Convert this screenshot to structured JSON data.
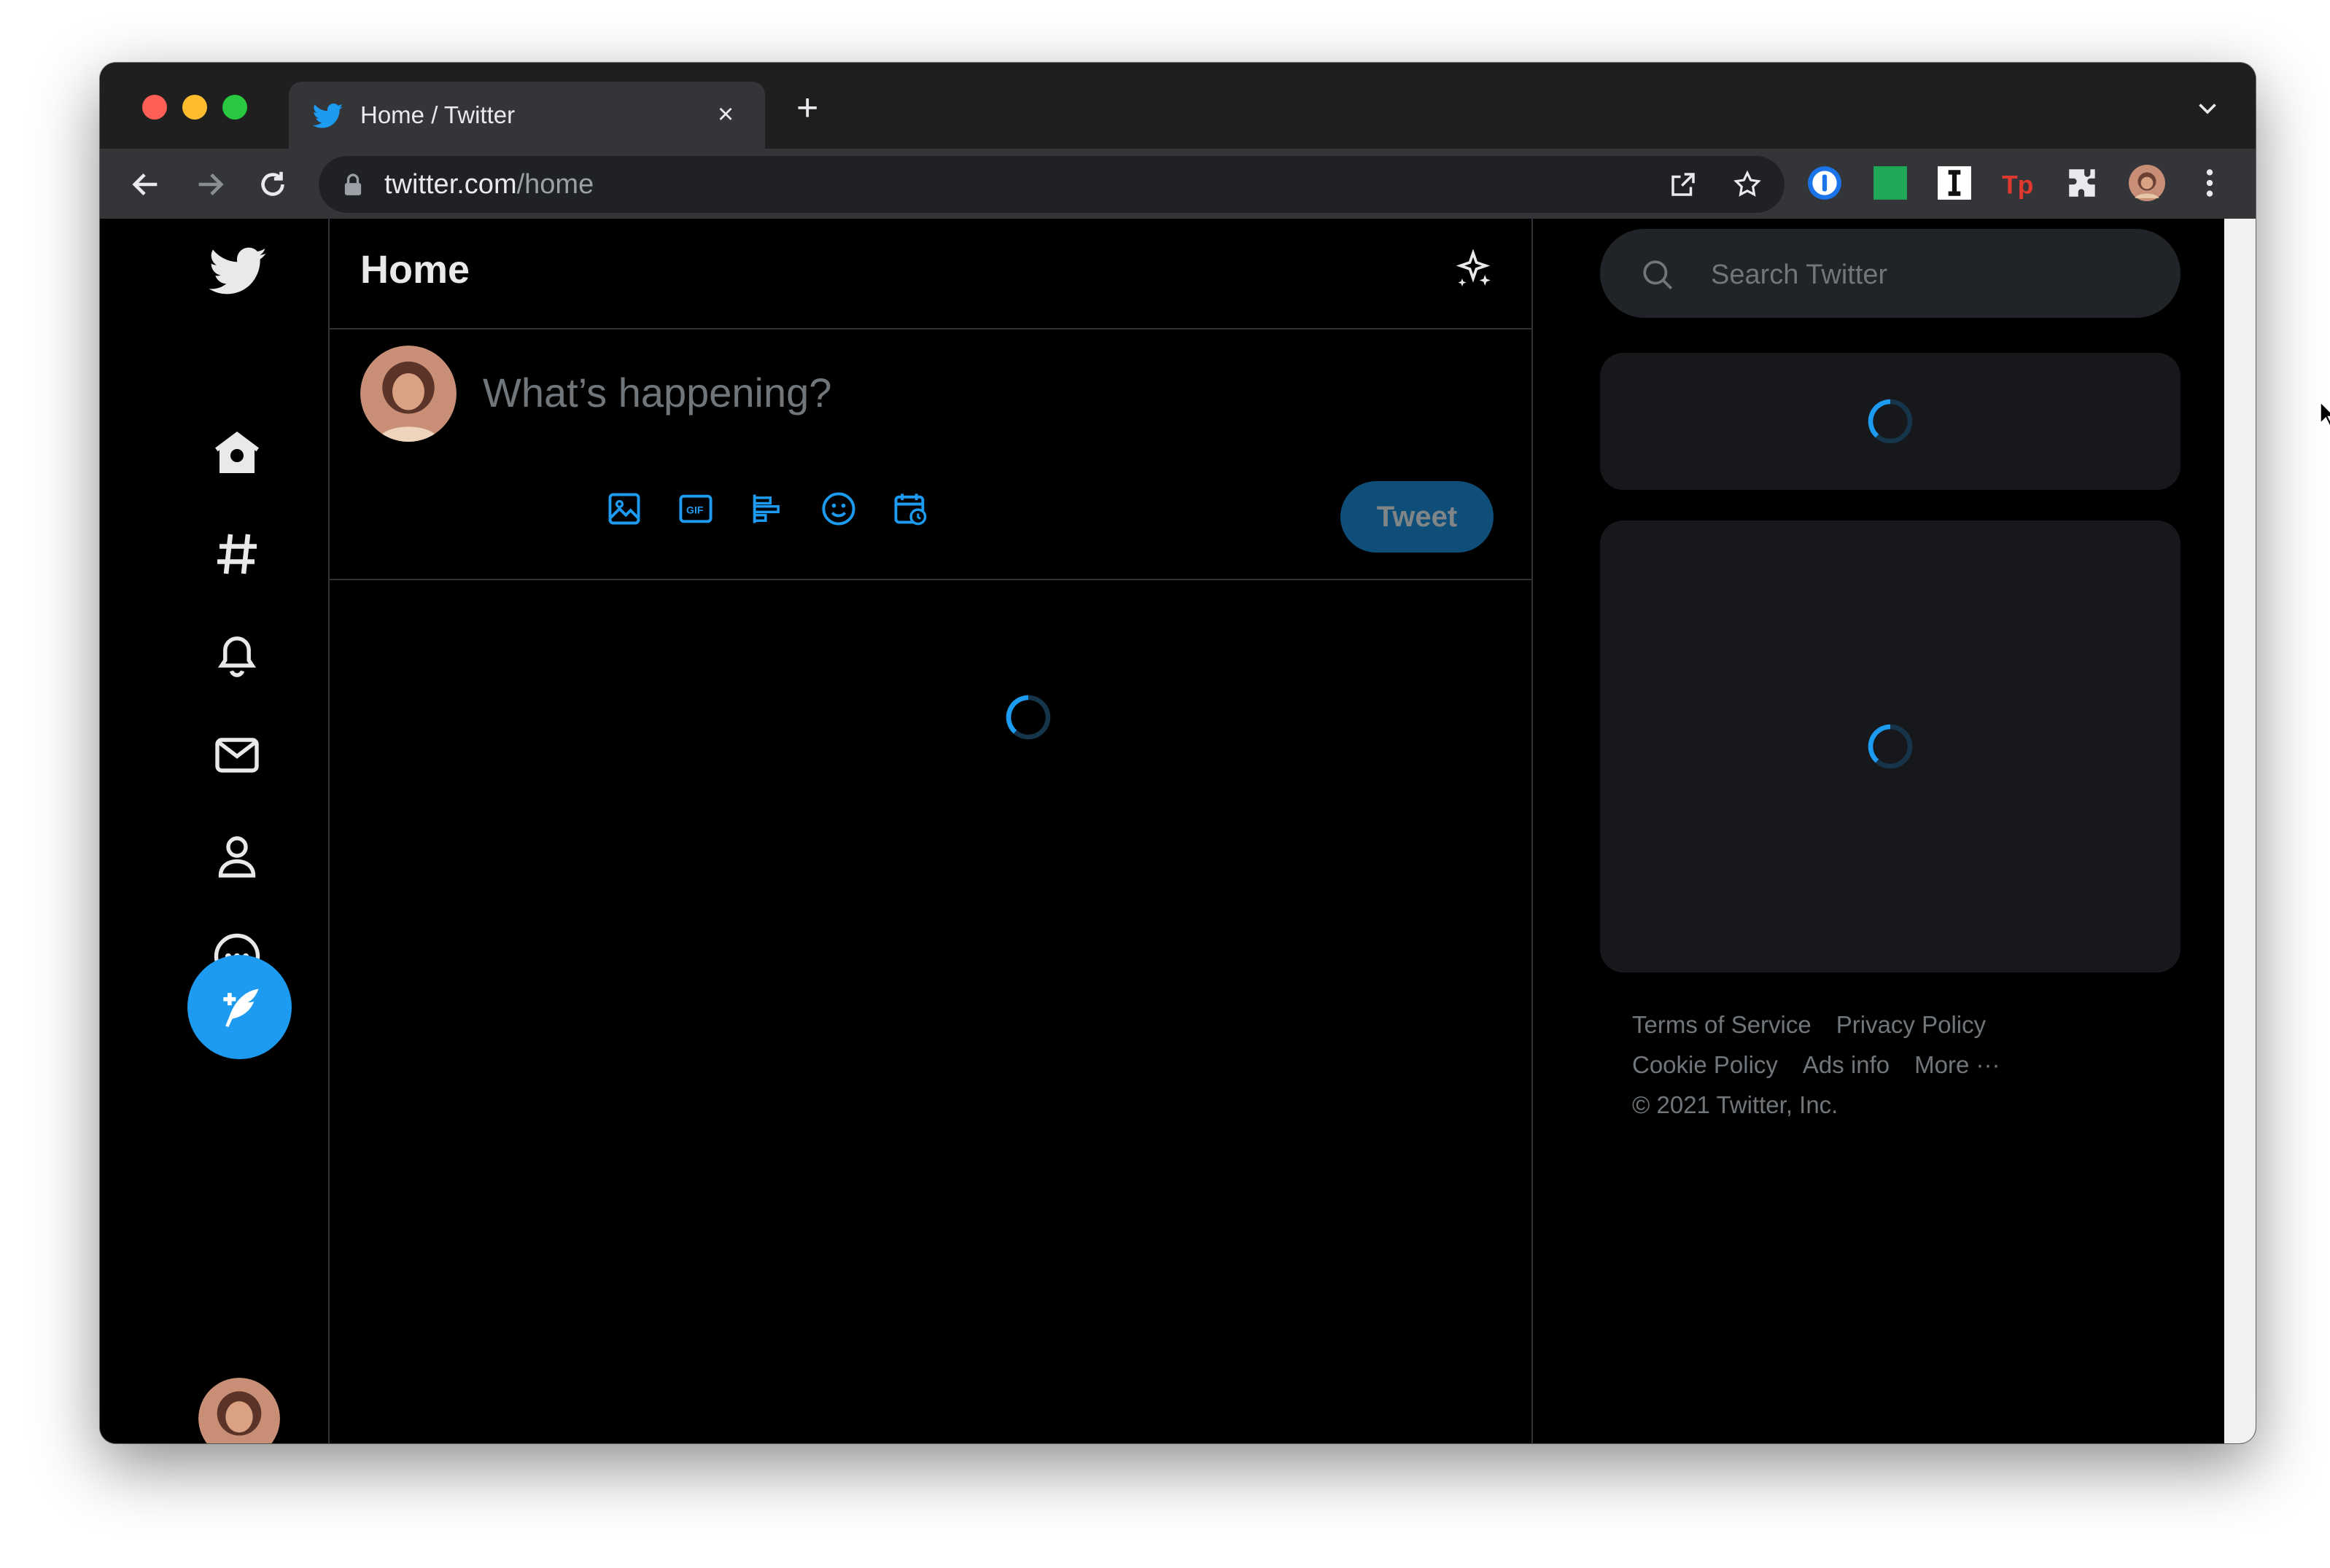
{
  "browser": {
    "tab_title": "Home / Twitter",
    "tab_close": "×",
    "new_tab": "+",
    "url_host": "twitter.com",
    "url_path": "/home"
  },
  "nav": {
    "items": [
      {
        "name": "home",
        "icon": "home-icon"
      },
      {
        "name": "explore",
        "icon": "hashtag-icon"
      },
      {
        "name": "notifications",
        "icon": "bell-icon"
      },
      {
        "name": "messages",
        "icon": "envelope-icon"
      },
      {
        "name": "profile",
        "icon": "person-icon"
      },
      {
        "name": "more",
        "icon": "more-circle-icon"
      }
    ],
    "compose_icon": "feather-plus-icon"
  },
  "timeline": {
    "title": "Home",
    "composer_placeholder": "What’s happening?",
    "tweet_button": "Tweet",
    "tools": [
      "image-icon",
      "gif-icon",
      "poll-icon",
      "emoji-icon",
      "schedule-icon"
    ]
  },
  "sidebar": {
    "search_placeholder": "Search Twitter",
    "footer": {
      "terms": "Terms of Service",
      "privacy": "Privacy Policy",
      "cookie": "Cookie Policy",
      "ads": "Ads info",
      "more": "More ···",
      "copyright": "© 2021 Twitter, Inc."
    }
  },
  "colors": {
    "accent": "#1d9bf0",
    "background": "#000000",
    "card": "#16181c",
    "muted_text": "#71767b"
  }
}
